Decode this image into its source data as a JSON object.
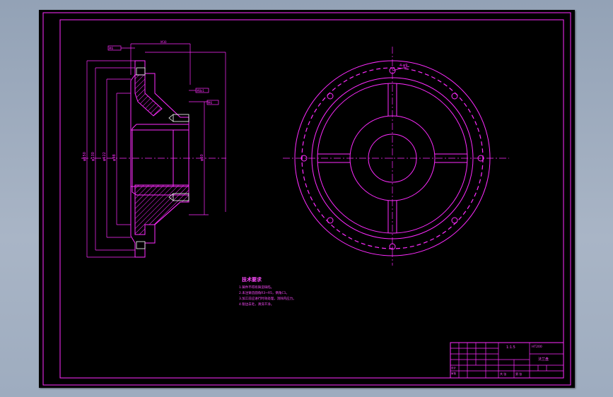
{
  "theme": {
    "line_color": "#ff2bff",
    "sheet_background": "#000000",
    "workspace_background": "#9eacbf",
    "accent_white": "#ffffff"
  },
  "section_view": {
    "dimension_labels": [
      "φ60",
      "φ98",
      "φ122",
      "φ130",
      "φ150"
    ],
    "callout_tags": [
      "M6",
      "M8x1",
      "M6",
      "M30"
    ]
  },
  "circular_view": {
    "centerline_label": "4-φ9"
  },
  "technical_notes": {
    "heading": "技术要求",
    "items": [
      "1.铸件不得有铸造缺陷。",
      "2.未注铸造圆角R3~R5，倒角C1。",
      "3.加工前应进行时效处理，消除内应力。",
      "4.锐边去毛，清洗干净。"
    ]
  },
  "title_block": {
    "scale_label": "1:1.5",
    "drawing_number": "HT200",
    "part_name": "法兰盘",
    "header_cells": [
      "标记",
      "处数",
      "分区",
      "更改文件号",
      "签名",
      "日期"
    ],
    "row_labels": [
      "设计",
      "审核",
      "工艺"
    ],
    "bottom_cells": [
      "共 张",
      "第 张"
    ]
  }
}
